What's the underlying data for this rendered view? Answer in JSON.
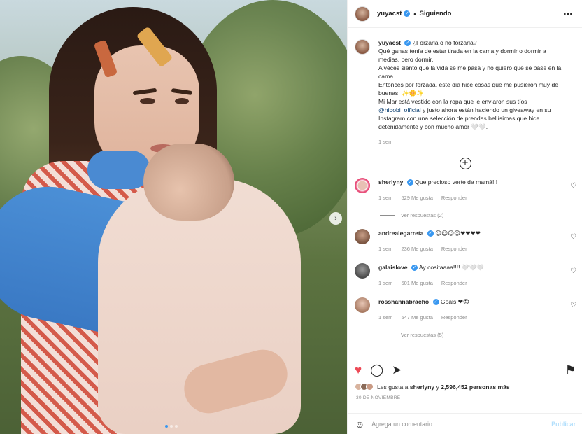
{
  "header": {
    "username": "yuyacst",
    "verified_mark": "✓",
    "separator": "•",
    "follow_status": "Siguiendo",
    "more_icon": "⋯"
  },
  "caption": {
    "username": "yuyacst",
    "verified_mark": "✓",
    "line1": "¿Forzarla o no forzarla?",
    "line2": "Qué ganas tenía de estar tirada en la cama y dormir o dormir a medias, pero dormir.",
    "line3": "A veces siento que la vida se me pasa y no quiero que se pase en la cama.",
    "line4": "Entonces por forzada, este día hice cosas que me pusieron muy de buenas. ✨🌼✨",
    "line5_pre": "Mi Mar está vestido con la ropa que le enviaron sus tíos ",
    "mention": "@hibobi_official",
    "line5_post": " y justo ahora están haciendo un giveaway en su Instagram con una selección de prendas bellísimas que hice detenidamente y con mucho amor 🤍🤍.",
    "time": "1 sem"
  },
  "load_more_icon": "+",
  "comments": [
    {
      "username": "sherlyny",
      "verified_mark": "✓",
      "text": "Que precioso verte de mamá!!!",
      "time": "1 sem",
      "likes": "529 Me gusta",
      "reply": "Responder",
      "replies": "Ver respuestas (2)",
      "avatar_color": "#e8c0b4"
    },
    {
      "username": "andrealegarreta",
      "verified_mark": "✓",
      "text": "😍😍😍😍❤❤❤❤",
      "time": "1 sem",
      "likes": "236 Me gusta",
      "reply": "Responder",
      "replies": "",
      "avatar_color": "#a0785e"
    },
    {
      "username": "galaislove",
      "verified_mark": "✓",
      "text": "Ay cositaaaa!!!! 🤍🤍🤍",
      "time": "1 sem",
      "likes": "501 Me gusta",
      "reply": "Responder",
      "replies": "",
      "avatar_color": "#6a6a6a"
    },
    {
      "username": "rosshannabracho",
      "verified_mark": "✓",
      "text": "Goals ❤😍",
      "time": "1 sem",
      "likes": "547 Me gusta",
      "reply": "Responder",
      "replies": "Ver respuestas (5)",
      "avatar_color": "#d9b3a0"
    }
  ],
  "actions": {
    "like_icon": "♥",
    "comment_icon": "◯",
    "share_icon": "➤",
    "save_icon": "⚑"
  },
  "likes": {
    "prefix": "Les gusta a ",
    "user": "sherlyny",
    "middle": " y ",
    "count": "2,596,452 personas más"
  },
  "date": "30 DE NOVIEMBRE",
  "add_comment": {
    "emoji_icon": "☺",
    "placeholder": "Agrega un comentario...",
    "post_label": "Publicar"
  },
  "carousel": {
    "next_icon": "›",
    "total": 3,
    "active": 1
  },
  "colors": {
    "verified": "#3897f0",
    "like": "#ed4956",
    "mention": "#00376b",
    "muted": "#8e8e8e",
    "post_disabled": "#b2dffc"
  }
}
